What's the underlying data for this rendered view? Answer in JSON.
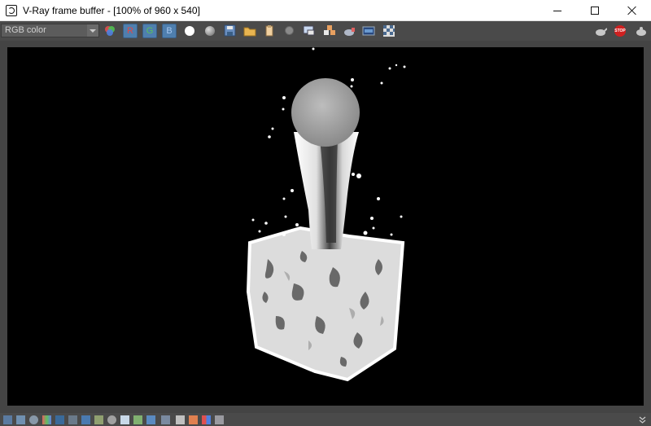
{
  "window": {
    "title": "V-Ray frame buffer - [100% of 960 x 540]"
  },
  "toolbar": {
    "channel_selector": {
      "value": "RGB color"
    },
    "channel_buttons": {
      "red": "R",
      "green": "G",
      "blue": "B"
    },
    "stop_label": "STOP"
  },
  "colors": {
    "toolbar_bg": "#4a4a4a",
    "channel_button_active": "#4f7fae",
    "render_bg": "#000000",
    "stop_red": "#d02020"
  },
  "icons": [
    "vray-logo-icon",
    "channel-colors-icon",
    "white-circle-icon",
    "gray-sphere-icon",
    "save-icon",
    "folder-icon",
    "clear-icon",
    "dark-circle-icon",
    "track-mouse-icon",
    "region-icon",
    "teapot-render-icon",
    "dr-icon",
    "checker-icon",
    "teapot-icon",
    "stop-icon",
    "teapot-options-icon",
    "chevron-down-icon"
  ]
}
